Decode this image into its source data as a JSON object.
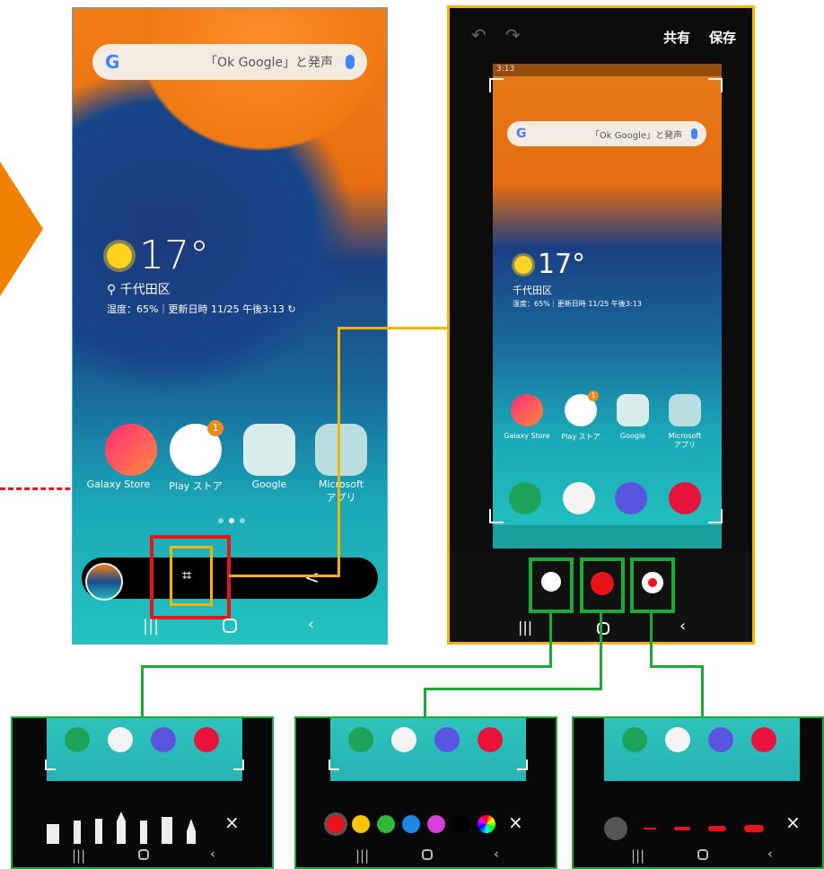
{
  "left_phone": {
    "search_text": "「Ok Google」と発声",
    "temperature": "17°",
    "location": "千代田区",
    "info": "湿度：65%｜更新日時 11/25 午後3:13",
    "apps": [
      "Galaxy Store",
      "Play ストア",
      "Google",
      "Microsoft\nアプリ"
    ],
    "badge": "1"
  },
  "right_phone": {
    "share_label": "共有",
    "save_label": "保存",
    "status_time": "3:13",
    "search_text": "「Ok Google」と発声",
    "temperature": "17°",
    "location": "千代田区",
    "info": "湿度：65%｜更新日時 11/25 午後3:13",
    "apps": [
      "Galaxy Store",
      "Play ストア",
      "Google",
      "Microsoft\nアプリ"
    ],
    "badge": "1"
  },
  "g_logo": "G",
  "close_label": "×",
  "colors": {
    "palette": [
      "#e8141a",
      "#ffc400",
      "#31b83a",
      "#1e88e5",
      "#d43fd8",
      "#000000"
    ],
    "accent_orange": "#f08000",
    "highlight_red": "#e8141a",
    "highlight_yellow": "#f5b400",
    "highlight_green": "#1eaa3a"
  },
  "icons": [
    "pen-icon",
    "color-icon",
    "stroke-size-icon",
    "crop-edit-icon",
    "share-icon"
  ]
}
